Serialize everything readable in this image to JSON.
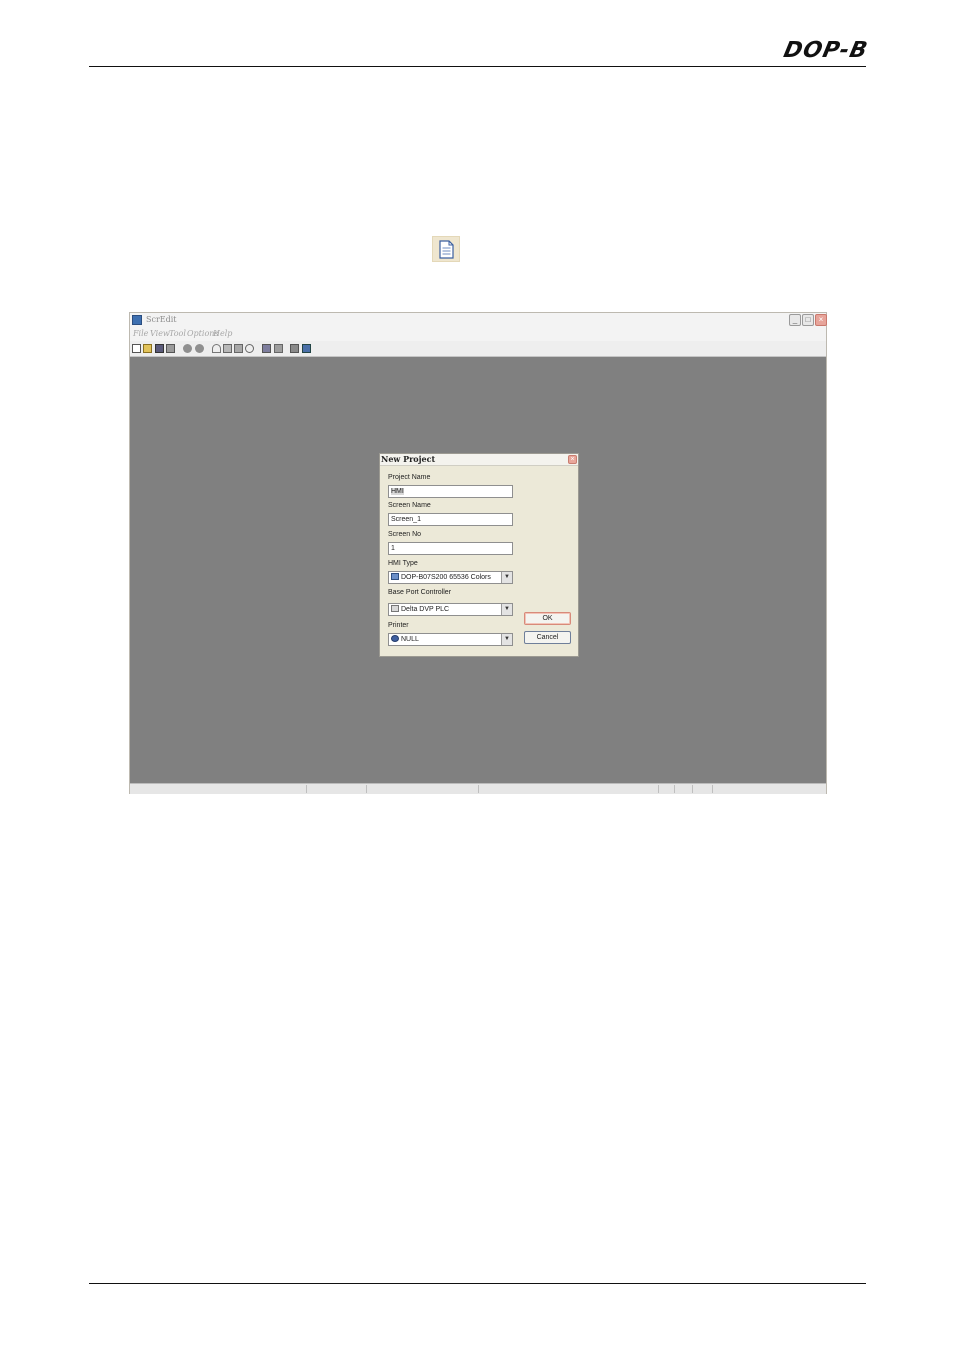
{
  "header": {
    "brand": "DOP-B"
  },
  "app": {
    "title": "ScrEdit",
    "window_buttons": {
      "minimize": "_",
      "maximize": "□",
      "close": "×"
    },
    "menu": [
      "File",
      "View",
      "Tool",
      "Options",
      "Help"
    ]
  },
  "dialog": {
    "title": "New Project",
    "close": "×",
    "fields": {
      "project_name": {
        "label": "Project Name",
        "value": "HMI"
      },
      "screen_name": {
        "label": "Screen Name",
        "value": "Screen_1"
      },
      "screen_no": {
        "label": "Screen No",
        "value": "1"
      },
      "hmi_type": {
        "label": "HMI Type",
        "value": "DOP-B07S200 65536 Colors"
      },
      "base_port_controller": {
        "label": "Base Port Controller",
        "value": "Delta DVP PLC"
      },
      "printer": {
        "label": "Printer",
        "value": "NULL"
      }
    },
    "dropdown_arrow": "▼",
    "buttons": {
      "ok": "OK",
      "cancel": "Cancel"
    }
  }
}
